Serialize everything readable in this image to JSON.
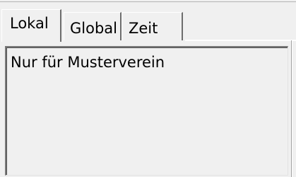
{
  "tabs": [
    {
      "label": "Lokal",
      "active": true
    },
    {
      "label": "Global",
      "active": false
    },
    {
      "label": "Zeit",
      "active": false
    }
  ],
  "panel": {
    "text": "Nur für Musterverein"
  }
}
